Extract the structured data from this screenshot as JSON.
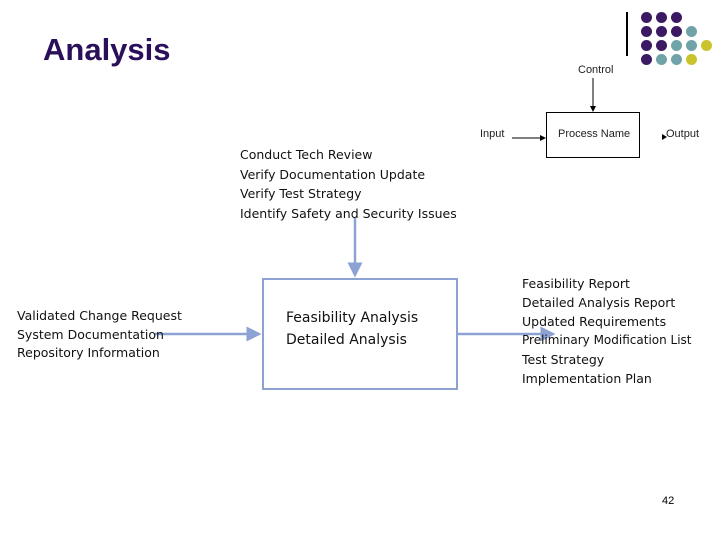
{
  "slide": {
    "title": "Analysis",
    "page_number": "42"
  },
  "legend_diagram": {
    "control_label": "Control",
    "input_label": "Input",
    "process_label": "Process Name",
    "output_label": "Output"
  },
  "controls": {
    "items": [
      "Conduct Tech Review",
      "Verify Documentation Update",
      "Verify Test Strategy",
      "Identify Safety and Security Issues"
    ]
  },
  "inputs": {
    "items": [
      "Validated Change Request",
      "System Documentation",
      "Repository Information"
    ]
  },
  "process": {
    "items": [
      "Feasibility Analysis",
      "Detailed Analysis"
    ]
  },
  "outputs": {
    "items": [
      "Feasibility Report",
      "Detailed Analysis Report",
      "Updated Requirements",
      "Preliminary Modification List",
      "Test Strategy",
      "Implementation Plan"
    ]
  },
  "colors": {
    "title": "#2a0f5a",
    "dot_purple": "#3b1a63",
    "dot_teal": "#6fa3a8",
    "dot_yellow": "#c9c42b",
    "arrow": "#8ca2d2"
  }
}
